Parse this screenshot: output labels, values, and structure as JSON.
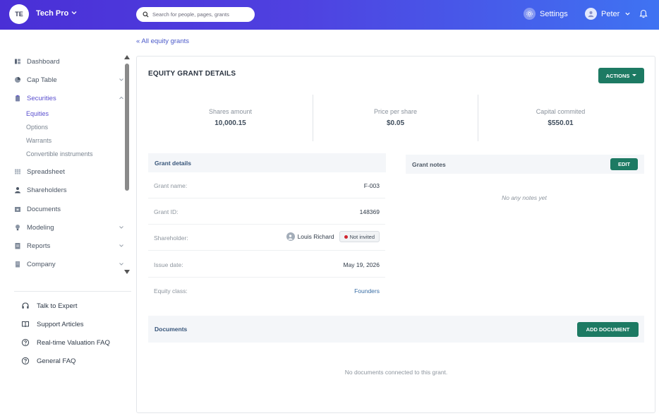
{
  "header": {
    "org_initials": "TE",
    "org_name": "Tech Pro",
    "search_placeholder": "Search for people, pages, grants",
    "settings_label": "Settings",
    "user_name": "Peter"
  },
  "sidebar": {
    "items": [
      {
        "label": "Dashboard",
        "icon": "dashboard-icon"
      },
      {
        "label": "Cap Table",
        "icon": "pie-chart-icon",
        "expandable": true
      },
      {
        "label": "Securities",
        "icon": "clipboard-icon",
        "expandable": true,
        "expanded": true,
        "active": true
      },
      {
        "label": "Spreadsheet",
        "icon": "grid-icon"
      },
      {
        "label": "Shareholders",
        "icon": "person-icon"
      },
      {
        "label": "Documents",
        "icon": "folder-icon"
      },
      {
        "label": "Modeling",
        "icon": "lightbulb-icon",
        "expandable": true
      },
      {
        "label": "Reports",
        "icon": "report-icon",
        "expandable": true
      },
      {
        "label": "Company",
        "icon": "building-icon",
        "expandable": true
      }
    ],
    "securities_sub": [
      "Equities",
      "Options",
      "Warrants",
      "Convertible instruments"
    ],
    "help": [
      {
        "label": "Talk to Expert",
        "icon": "headset-icon"
      },
      {
        "label": "Support Articles",
        "icon": "book-icon"
      },
      {
        "label": "Real-time Valuation FAQ",
        "icon": "question-circle-icon"
      },
      {
        "label": "General FAQ",
        "icon": "question-circle-icon"
      }
    ]
  },
  "main": {
    "back_link": "All equity grants",
    "title": "EQUITY GRANT DETAILS",
    "actions_label": "ACTIONS",
    "stats": [
      {
        "label": "Shares amount",
        "value": "10,000.15"
      },
      {
        "label": "Price per share",
        "value": "$0.05"
      },
      {
        "label": "Capital commited",
        "value": "$550.01"
      }
    ],
    "grant_details": {
      "title": "Grant details",
      "rows": [
        {
          "label": "Grant name:",
          "value": "F-003"
        },
        {
          "label": "Grant ID:",
          "value": "148369"
        },
        {
          "label": "Shareholder:",
          "value": "Louis Richard",
          "badge": "Not invited"
        },
        {
          "label": "Issue date:",
          "value": "May 19, 2026"
        },
        {
          "label": "Equity class:",
          "value": "Founders"
        }
      ]
    },
    "grant_notes": {
      "title": "Grant notes",
      "edit_label": "EDIT",
      "empty_text": "No any notes yet"
    },
    "documents": {
      "title": "Documents",
      "add_label": "ADD DOCUMENT",
      "empty_text": "No documents connected to this grant."
    }
  },
  "colors": {
    "primary_button": "#1d7a63",
    "active_nav": "#5a4fcf",
    "header_gradient_start": "#4a2fd6",
    "header_gradient_end": "#3f73f2",
    "status_dot": "#d0252f"
  }
}
